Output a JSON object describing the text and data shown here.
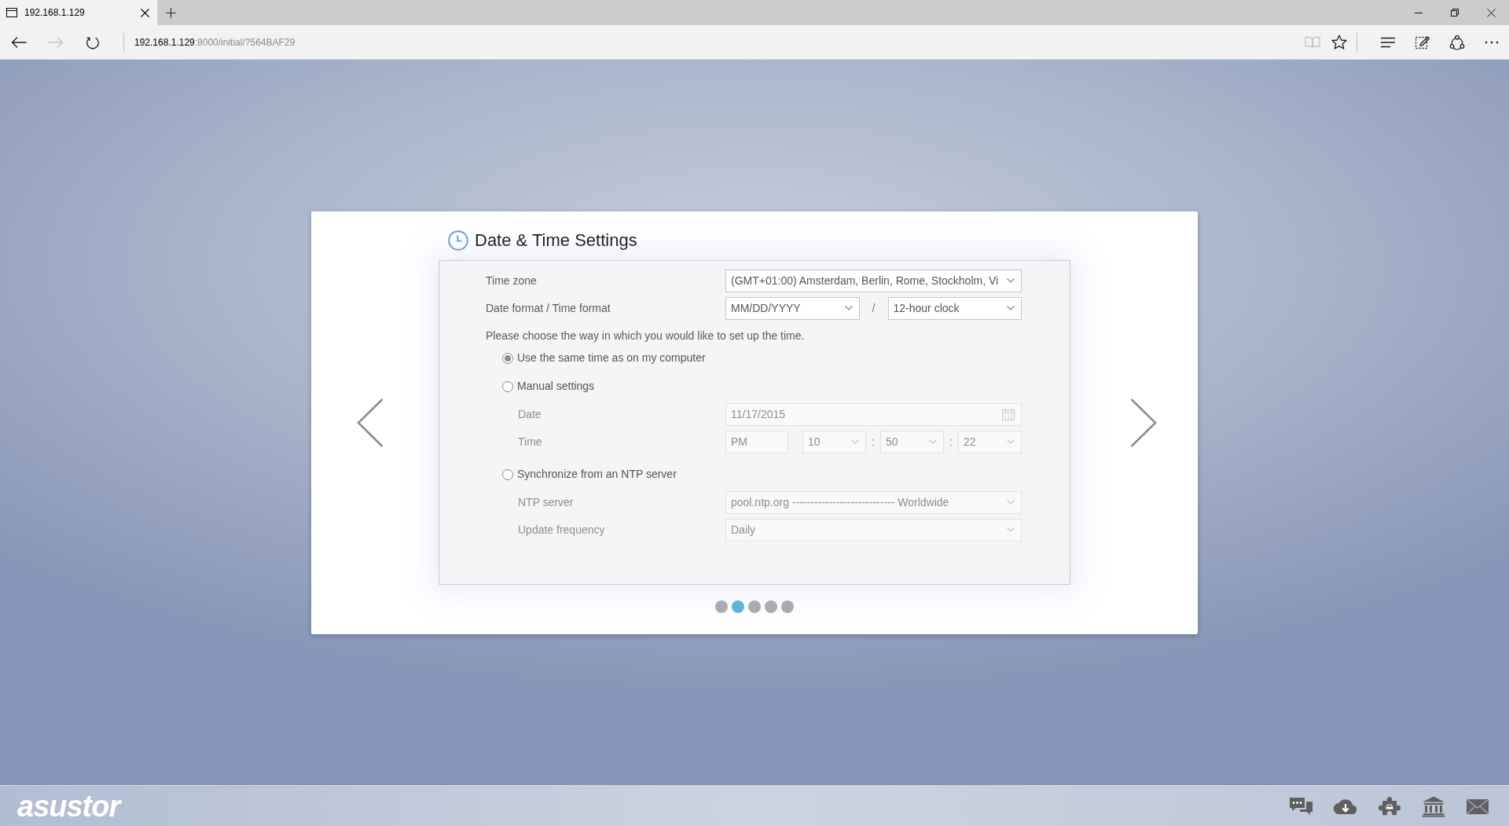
{
  "browser": {
    "tabs": [
      {
        "title": "192.168.1.129",
        "selected": true
      }
    ],
    "nav": [
      {
        "kind": "back",
        "disabled": false
      },
      {
        "kind": "forward",
        "disabled": true
      },
      {
        "kind": "refresh",
        "disabled": false
      }
    ],
    "address": {
      "host": "192.168.1.129",
      "rest": ":8000/initial/?564BAF29"
    },
    "toolbar_groups": [
      [
        {
          "kind": "reading-view",
          "disabled": true
        },
        {
          "kind": "favorite",
          "disabled": false
        }
      ],
      [
        {
          "kind": "hub",
          "disabled": false
        },
        {
          "kind": "web-note",
          "disabled": false
        },
        {
          "kind": "share",
          "disabled": false
        },
        {
          "kind": "more",
          "disabled": false
        }
      ]
    ]
  },
  "wizard": {
    "title": "Date & Time Settings",
    "rows": [
      {
        "label": "Time zone",
        "controls": [
          {
            "kind": "select",
            "value": "(GMT+01:00) Amsterdam, Berlin, Rome, Stockholm, Vi"
          }
        ]
      },
      {
        "label": "Date format / Time format",
        "controls": [
          {
            "kind": "select",
            "value": "MM/DD/YYYY"
          },
          {
            "kind": "sep",
            "text": "/"
          },
          {
            "kind": "select",
            "value": "12-hour clock"
          }
        ]
      }
    ],
    "prompt": "Please choose the way in which you would like to set up the time.",
    "options": [
      {
        "label": "Use the same time as on my computer",
        "selected": true
      },
      {
        "label": "Manual settings",
        "selected": false,
        "fields": [
          {
            "label": "Date",
            "disabled": true,
            "controls": [
              {
                "kind": "date",
                "value": "11/17/2015"
              }
            ]
          },
          {
            "label": "Time",
            "disabled": true,
            "controls": [
              {
                "kind": "box",
                "value": "PM"
              },
              {
                "kind": "select",
                "value": "10"
              },
              {
                "kind": "sep",
                "text": ":"
              },
              {
                "kind": "select",
                "value": "50"
              },
              {
                "kind": "sep",
                "text": ":"
              },
              {
                "kind": "select",
                "value": "22"
              }
            ]
          }
        ]
      },
      {
        "label": "Synchronize from an NTP server",
        "selected": false,
        "fields": [
          {
            "label": "NTP server",
            "disabled": true,
            "controls": [
              {
                "kind": "select",
                "value": "pool.ntp.org ---------------------------- Worldwide"
              }
            ]
          },
          {
            "label": "Update frequency",
            "disabled": true,
            "controls": [
              {
                "kind": "select",
                "value": "Daily"
              }
            ]
          }
        ]
      }
    ],
    "steps": [
      {
        "selected": false
      },
      {
        "selected": true
      },
      {
        "selected": false
      },
      {
        "selected": false
      },
      {
        "selected": false
      }
    ]
  },
  "footer": {
    "logo": "asustor"
  }
}
